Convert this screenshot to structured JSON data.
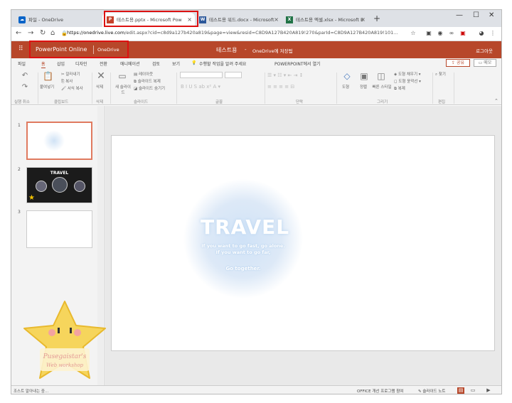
{
  "browser": {
    "tabs": [
      {
        "label": "파일 - OneDrive",
        "icon": "onedrive-icon"
      },
      {
        "label": "테스트용.pptx - Microsoft Pow",
        "icon": "powerpoint-icon",
        "active": true
      },
      {
        "label": "테스트용 워드.docx - Microsoft",
        "icon": "word-icon"
      },
      {
        "label": "테스트용 엑셀.xlsx - Microsoft E",
        "icon": "excel-icon"
      }
    ],
    "new_tab": "+",
    "url_host": "https://onedrive.live.com",
    "url_path": "/edit.aspx?cid=c8d9a127b420a819&page=view&resid=C8D9A127B420A819!270&parId=C8D9A127B420A819!101..."
  },
  "app": {
    "name": "PowerPoint Online",
    "location": "OneDrive",
    "doc_title": "테스트용",
    "separator": "-",
    "saved_status": "OneDrive에 저장됨",
    "sign_out": "로그아웃"
  },
  "menu": {
    "tabs": [
      "파일",
      "홈",
      "삽입",
      "디자인",
      "전환",
      "애니메이션",
      "검토",
      "보기",
      "수행할 작업을 알려 주세요",
      "POWERPOINT에서 열기"
    ],
    "share": "공유",
    "memo": "메모"
  },
  "ribbon": {
    "undo_group": "실행 취소",
    "paste": "붙여넣기",
    "cut": "잘라내기",
    "copy": "복사",
    "format_painter": "서식 복사",
    "clipboard_group": "클립보드",
    "delete": "삭제",
    "delete_group": "삭제",
    "new_slide": "새 슬라이드",
    "layout": "레이아웃",
    "duplicate_slide": "슬라이드 복제",
    "hide_slide": "슬라이드 숨기기",
    "slides_group": "슬라이드",
    "font_group": "글꼴",
    "paragraph_group": "단락",
    "shapes": "도형",
    "arrange": "정렬",
    "quick_styles": "빠른 스타일",
    "shape_fill": "도형 채우기",
    "shape_outline": "도형 윤곽선",
    "duplicate": "복제",
    "drawing_group": "그리기",
    "find": "찾기",
    "edit_group": "편집"
  },
  "slides": {
    "numbers": [
      "1",
      "2",
      "3"
    ],
    "thumb2_title": "TRAVEL"
  },
  "slide": {
    "title": "TRAVEL",
    "line1": "If you want to go fast, go alone.",
    "line2": "If you want to go far,",
    "line3": "Go together."
  },
  "status": {
    "left": "조스트 알아내는 중...",
    "improve": "OFFICE 개선 프로그램 참여",
    "notes": "슬라이드 노트"
  },
  "watermark": {
    "line1": "Pusegaistar's",
    "line2": "Web workshop"
  }
}
